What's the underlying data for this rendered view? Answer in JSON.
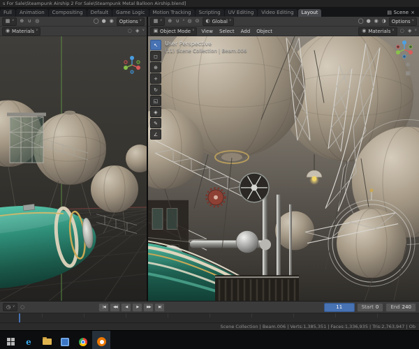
{
  "colors": {
    "accent_blue": "#4772b3",
    "hull_teal": "#2f8f79",
    "balloon_tan": "#a49884",
    "scaffold_silver": "#d8d6d1",
    "taskbar_highlight": "#5fb2e8",
    "blender_orange": "#ea7600"
  },
  "titlebar": {
    "title": "s For Sale\\Steampunk Airship 2 For Sale\\Steampunk Metal Balloon Airship.blend]"
  },
  "tabs": {
    "items": [
      "Full",
      "Animation",
      "Compositing",
      "Default",
      "Game Logic",
      "Motion Tracking",
      "Scripting",
      "UV Editing",
      "Video Editing",
      "Layout"
    ],
    "scene_label": "Scene"
  },
  "icons": {
    "editor_viewport": "▦",
    "editor_timeline": "◷",
    "caret_down": "∨",
    "cursor_3d": "⊕",
    "magnet": "∪",
    "proportional": "◎",
    "pivot": "⊙",
    "globe": "◐",
    "shading_wireframe": "◯",
    "shading_solid": "●",
    "shading_material": "◉",
    "shading_rendered": "◑",
    "overlays": "◌",
    "gizmos": "◈",
    "mode_cube": "▣",
    "scene": "▤",
    "close": "×",
    "zoom": "⊕",
    "camera": "▦"
  },
  "left_viewport": {
    "shading_dropdown": "Materials",
    "options_label": "Options"
  },
  "right_viewport": {
    "mode_dropdown": "Object Mode",
    "menus": [
      "View",
      "Select",
      "Add",
      "Object"
    ],
    "orientation": "Global",
    "shading_dropdown": "Materials",
    "options_label": "Options",
    "overlay_line1": "User Perspective",
    "overlay_line2": "(11) Scene Collection | Beam.006",
    "tools": [
      {
        "name": "tweak-select",
        "glyph": "↖"
      },
      {
        "name": "select-box",
        "glyph": "◻"
      },
      {
        "name": "cursor",
        "glyph": "⊕"
      },
      {
        "name": "move",
        "glyph": "+"
      },
      {
        "name": "rotate",
        "glyph": "↻"
      },
      {
        "name": "scale",
        "glyph": "◱"
      },
      {
        "name": "transform",
        "glyph": "◈"
      },
      {
        "name": "annotate",
        "glyph": "✎"
      },
      {
        "name": "measure",
        "glyph": "∠"
      }
    ]
  },
  "timeline": {
    "playback": [
      {
        "name": "jump-to-start",
        "glyph": "|◀"
      },
      {
        "name": "prev-keyframe",
        "glyph": "◀◀"
      },
      {
        "name": "play-reverse",
        "glyph": "◀"
      },
      {
        "name": "play-forward",
        "glyph": "▶"
      },
      {
        "name": "next-keyframe",
        "glyph": "▶▶"
      },
      {
        "name": "jump-to-end",
        "glyph": "▶|"
      }
    ],
    "current_frame": "11",
    "start_label": "Start",
    "start_value": "0",
    "end_label": "End",
    "end_value": "240"
  },
  "statusbar": {
    "stats": "Scene Collection | Beam.006 | Verts:1,385,351 | Faces:1,336,935 | Tris:2,763,947 | Ob"
  }
}
